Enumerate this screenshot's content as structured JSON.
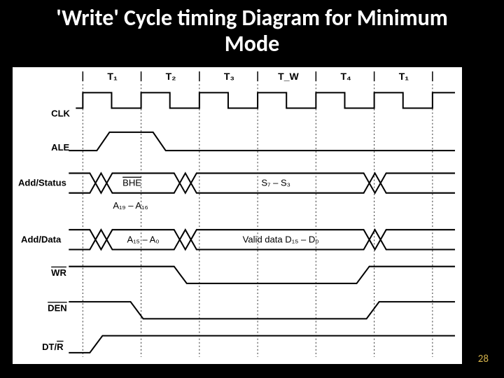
{
  "title": "'Write' Cycle timing Diagram for Minimum Mode",
  "page_number": "28",
  "time_labels": [
    "T₁",
    "T₂",
    "T₃",
    "T_W",
    "T₄",
    "T₁"
  ],
  "signals": {
    "clk": "CLK",
    "ale": "ALE",
    "addr_status": "Add/Status",
    "addr_data": "Add/Data",
    "wr": "WR",
    "den": "DEN",
    "dtr": "DT/R"
  },
  "bus_labels": {
    "bhe": "BHE",
    "s7_s3": "S₇ – S₃",
    "a19_a16": "A₁₉ – A₁₆",
    "a15_a0": "A₁₅ – A₀",
    "valid_data": "Valid data D₁₅ – D₀"
  },
  "chart_data": {
    "type": "timing-diagram",
    "clock_periods": [
      "T1",
      "T2",
      "T3",
      "TW",
      "T4",
      "T1"
    ],
    "signals": [
      {
        "name": "CLK",
        "type": "clock"
      },
      {
        "name": "ALE",
        "type": "pulse",
        "high_during": [
          "T1-late",
          "T2-early"
        ]
      },
      {
        "name": "Add/Status",
        "type": "bus",
        "segments": [
          {
            "label": "",
            "span": "before T1"
          },
          {
            "label": "BHE",
            "span": "T1–T2"
          },
          {
            "label": "S7-S3",
            "span": "T2–T4"
          },
          {
            "label": "",
            "span": "after T4"
          }
        ],
        "sublabel": "A19–A16"
      },
      {
        "name": "Add/Data",
        "type": "bus",
        "segments": [
          {
            "label": "",
            "span": "before T1"
          },
          {
            "label": "A15–A0",
            "span": "T1–T2"
          },
          {
            "label": "Valid data D15–D0",
            "span": "T2–T4"
          },
          {
            "label": "",
            "span": "after T4"
          }
        ]
      },
      {
        "name": "WR",
        "type": "level",
        "low_during": "T2–T4",
        "active_low": true
      },
      {
        "name": "DEN",
        "type": "level",
        "low_during": "late T1–T4",
        "active_low": true
      },
      {
        "name": "DT/R",
        "type": "level",
        "high_during": "T1–beyond",
        "rises": "early T1"
      }
    ]
  }
}
